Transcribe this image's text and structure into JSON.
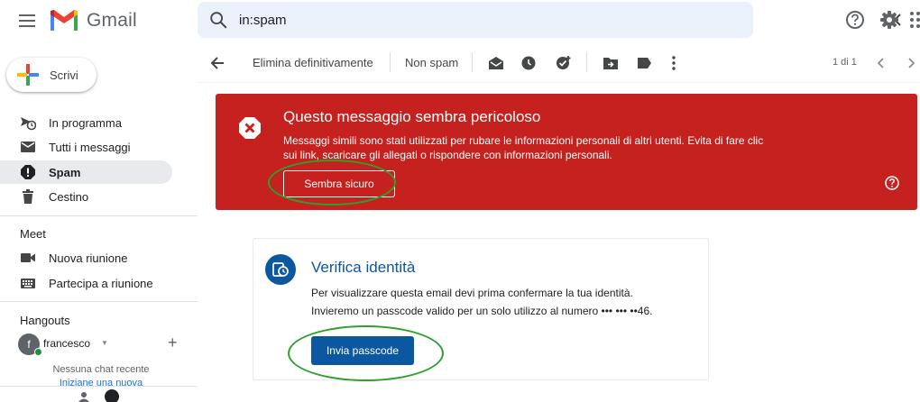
{
  "app": {
    "name": "Gmail"
  },
  "search": {
    "value": "in:spam"
  },
  "sidebar": {
    "compose_label": "Scrivi",
    "items": [
      {
        "label": "In programma",
        "icon": "scheduled-send-icon"
      },
      {
        "label": "Tutti i messaggi",
        "icon": "all-mail-icon"
      },
      {
        "label": "Spam",
        "icon": "spam-icon",
        "active": true
      },
      {
        "label": "Cestino",
        "icon": "trash-icon"
      }
    ],
    "meet": {
      "title": "Meet",
      "items": [
        {
          "label": "Nuova riunione",
          "icon": "video-camera-icon"
        },
        {
          "label": "Partecipa a riunione",
          "icon": "keyboard-icon"
        }
      ]
    },
    "hangouts": {
      "title": "Hangouts",
      "user_initial": "f",
      "user_name": "francesco",
      "no_chat": "Nessuna chat recente",
      "new_chat": "Iniziane una nuova"
    }
  },
  "toolbar": {
    "delete_forever": "Elimina definitivamente",
    "not_spam": "Non spam",
    "pager": "1 di 1"
  },
  "warning": {
    "title": "Questo messaggio sembra pericoloso",
    "line1": "Messaggi simili sono stati utilizzati per rubare le informazioni personali di altri utenti. Evita di fare clic",
    "line2": "sui link, scaricare gli allegati o rispondere con informazioni personali.",
    "button": "Sembra sicuro",
    "color": "#c5221f"
  },
  "card": {
    "title": "Verifica identità",
    "line1": "Per visualizzare questa email devi prima confermare la tua identità.",
    "line2": "Invieremo un passcode valido per un solo utilizzo al numero ••• ••• ••46.",
    "button": "Invia passcode",
    "color": "#0b57a0"
  },
  "annotations": {
    "ring_color": "#2ca02c"
  }
}
